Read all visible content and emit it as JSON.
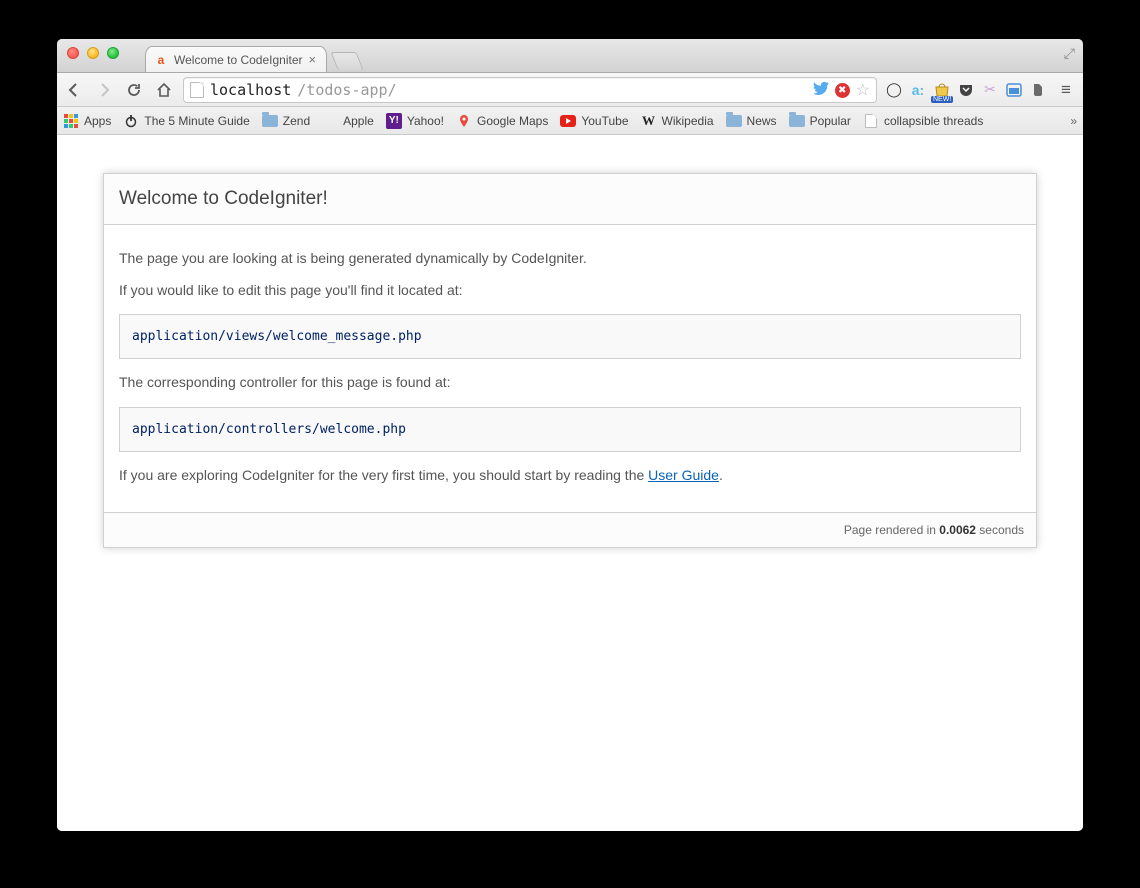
{
  "tab": {
    "title": "Welcome to CodeIgniter"
  },
  "url": {
    "host": "localhost",
    "path": "/todos-app/"
  },
  "bookmarks": {
    "apps": "Apps",
    "items": [
      "The 5 Minute Guide",
      "Zend",
      "Apple",
      "Yahoo!",
      "Google Maps",
      "YouTube",
      "Wikipedia",
      "News",
      "Popular",
      "collapsible threads"
    ]
  },
  "page": {
    "heading": "Welcome to CodeIgniter!",
    "p1": "The page you are looking at is being generated dynamically by CodeIgniter.",
    "p2": "If you would like to edit this page you'll find it located at:",
    "code1": "application/views/welcome_message.php",
    "p3": "The corresponding controller for this page is found at:",
    "code2": "application/controllers/welcome.php",
    "p4_prefix": "If you are exploring CodeIgniter for the very first time, you should start by reading the ",
    "p4_link": "User Guide",
    "p4_suffix": ".",
    "footer_prefix": "Page rendered in ",
    "footer_time": "0.0062",
    "footer_suffix": " seconds"
  },
  "ext_badge": "NEW!"
}
